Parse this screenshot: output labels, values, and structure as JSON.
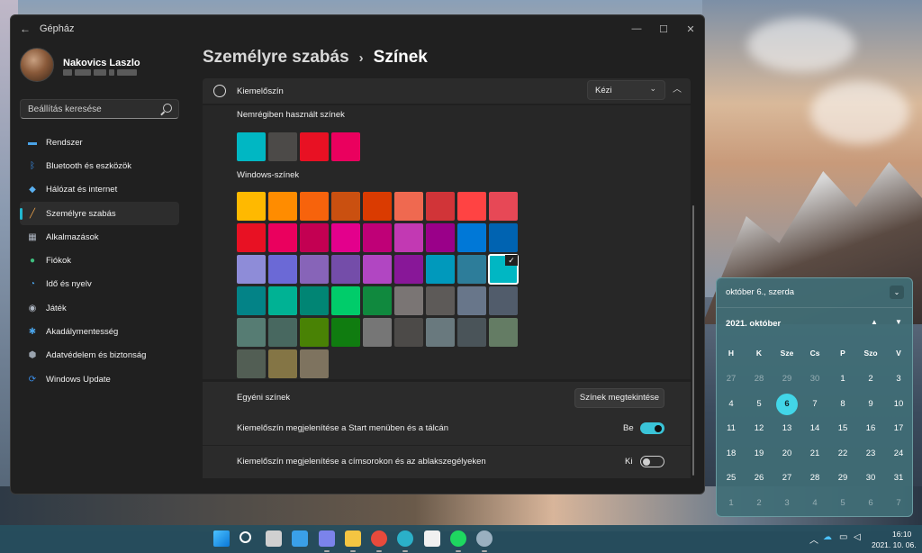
{
  "window": {
    "app_title": "Gépház",
    "controls": {
      "minimize": "—",
      "maximize": "☐",
      "close": "✕"
    }
  },
  "profile": {
    "name": "Nakovics Laszlo"
  },
  "search": {
    "placeholder": "Beállítás keresése"
  },
  "sidebar": {
    "items": [
      {
        "label": "Rendszer",
        "icon": "monitor-icon",
        "color": "#4aa3e8"
      },
      {
        "label": "Bluetooth és eszközök",
        "icon": "bluetooth-icon",
        "color": "#3b8ee8"
      },
      {
        "label": "Hálózat és internet",
        "icon": "wifi-icon",
        "color": "#5ab0f0"
      },
      {
        "label": "Személyre szabás",
        "icon": "brush-icon",
        "color": "#e8a04a",
        "active": true
      },
      {
        "label": "Alkalmazások",
        "icon": "apps-icon",
        "color": "#b0b8c4"
      },
      {
        "label": "Fiókok",
        "icon": "person-icon",
        "color": "#3fbf7f"
      },
      {
        "label": "Idő és nyelv",
        "icon": "globe-clock-icon",
        "color": "#4aa3e8"
      },
      {
        "label": "Játék",
        "icon": "gamepad-icon",
        "color": "#b0b8c4"
      },
      {
        "label": "Akadálymentesség",
        "icon": "accessibility-icon",
        "color": "#4aa3e8"
      },
      {
        "label": "Adatvédelem és biztonság",
        "icon": "shield-icon",
        "color": "#9aa3ae"
      },
      {
        "label": "Windows Update",
        "icon": "update-icon",
        "color": "#3b8ee8"
      }
    ]
  },
  "header": {
    "breadcrumb": "Személyre szabás",
    "separator": "›",
    "title": "Színek"
  },
  "accent": {
    "label": "Kiemelőszín",
    "mode": "Kézi",
    "recent_title": "Nemrégiben használt színek",
    "recent_colors": [
      "#00b7c3",
      "#4c4a48",
      "#e81123",
      "#ea005e"
    ],
    "windows_title": "Windows-színek",
    "windows_colors": [
      [
        "#ffb900",
        "#ff8c00",
        "#f7630c",
        "#ca5010",
        "#da3b01",
        "#ef6950",
        "#d13438",
        "#ff4343",
        "#e74856"
      ],
      [
        "#e81123",
        "#ea005e",
        "#c30052",
        "#e3008c",
        "#bf0077",
        "#c239b3",
        "#9a0089",
        "#0078d7",
        "#0063b1"
      ],
      [
        "#8e8cd8",
        "#6b69d6",
        "#8764b8",
        "#744da9",
        "#b146c2",
        "#881798",
        "#0099bc",
        "#2d7d9a",
        "#00b7c3"
      ],
      [
        "#038387",
        "#00b294",
        "#018574",
        "#00cc6a",
        "#10893e",
        "#7a7574",
        "#5d5a58",
        "#68768a",
        "#515c6b"
      ],
      [
        "#567c73",
        "#486860",
        "#498205",
        "#107c10",
        "#767676",
        "#4c4a48",
        "#69797e",
        "#4a5459",
        "#647c64"
      ],
      [
        "#525e54",
        "#847545",
        "#7e735f"
      ]
    ],
    "selected": {
      "row": 2,
      "col": 8
    },
    "check_glyph": "✓"
  },
  "rows": {
    "custom_label": "Egyéni színek",
    "custom_button": "Színek megtekintése",
    "start_label": "Kiemelőszín megjelenítése a Start menüben és a tálcán",
    "start_state": "Be",
    "titlebar_label": "Kiemelőszín megjelenítése a címsorokon és az ablakszegélyeken",
    "titlebar_state": "Ki"
  },
  "calendar": {
    "full_date": "október 6., szerda",
    "month": "2021. október",
    "weekdays": [
      "H",
      "K",
      "Sze",
      "Cs",
      "P",
      "Szo",
      "V"
    ],
    "weeks": [
      [
        "27",
        "28",
        "29",
        "30",
        "1",
        "2",
        "3"
      ],
      [
        "4",
        "5",
        "6",
        "7",
        "8",
        "9",
        "10"
      ],
      [
        "11",
        "12",
        "13",
        "14",
        "15",
        "16",
        "17"
      ],
      [
        "18",
        "19",
        "20",
        "21",
        "22",
        "23",
        "24"
      ],
      [
        "25",
        "26",
        "27",
        "28",
        "29",
        "30",
        "31"
      ],
      [
        "1",
        "2",
        "3",
        "4",
        "5",
        "6",
        "7"
      ]
    ],
    "muted_first_week_count": 4,
    "today": "6"
  },
  "taskbar": {
    "apps": [
      {
        "name": "start-button-icon",
        "color": "#4cc2ff"
      },
      {
        "name": "search-icon",
        "color": "#ffffff"
      },
      {
        "name": "task-view-icon",
        "color": "#d0d0d0"
      },
      {
        "name": "widgets-icon",
        "color": "#3aa0e8"
      },
      {
        "name": "teams-chat-icon",
        "color": "#7b83eb"
      },
      {
        "name": "file-explorer-icon",
        "color": "#f4c542"
      },
      {
        "name": "chrome-icon",
        "color": "#e84a3c"
      },
      {
        "name": "edge-icon",
        "color": "#2bb0c8"
      },
      {
        "name": "store-icon",
        "color": "#f0f0f0"
      },
      {
        "name": "spotify-icon",
        "color": "#1ed760"
      },
      {
        "name": "settings-icon",
        "color": "#9ab0c0"
      }
    ],
    "time": "16:10",
    "date": "2021. 10. 06."
  }
}
